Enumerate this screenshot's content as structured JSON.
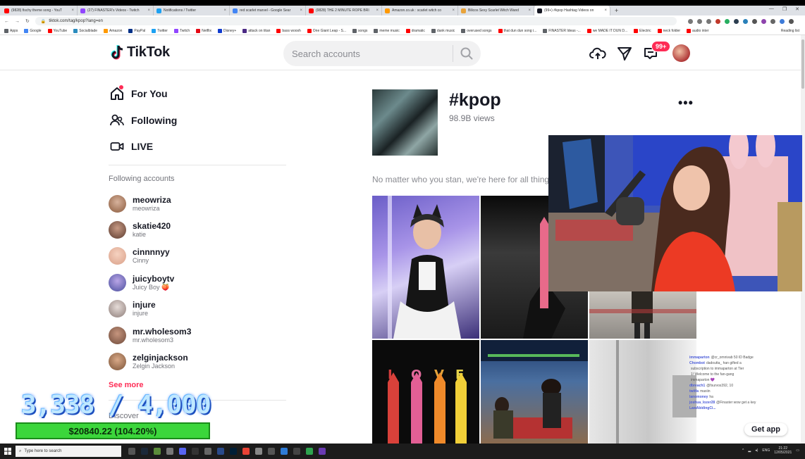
{
  "browser": {
    "tabs": [
      {
        "title": "(9828) fischy theme song - YouT",
        "color": "#ff0000"
      },
      {
        "title": "(27) FINASTER's Videos - Twitch",
        "color": "#9146ff"
      },
      {
        "title": "Notifications / Twitter",
        "color": "#1da1f2"
      },
      {
        "title": "red scarlet marvel - Google Sear",
        "color": "#4285f4"
      },
      {
        "title": "(9828) THE 2 MINUTE ROPE BRI",
        "color": "#ff0000"
      },
      {
        "title": "Amazon.co.uk : scarlet witch co",
        "color": "#ff9900"
      },
      {
        "title": "Bilicos Sexy Scarlet Witch Wand",
        "color": "#e8a33a"
      },
      {
        "title": "(99+) #kpop Hashtag Videos on",
        "color": "#161823"
      }
    ],
    "new_tab": "+",
    "url": "tiktok.com/tag/kpop?lang=en",
    "bookmarks": [
      {
        "label": "Apps",
        "color": "#5f6368"
      },
      {
        "label": "Google",
        "color": "#4285f4"
      },
      {
        "label": "YouTube",
        "color": "#ff0000"
      },
      {
        "label": "Socialblade",
        "color": "#2b8cbe"
      },
      {
        "label": "Amazon",
        "color": "#ff9900"
      },
      {
        "label": "PayPal",
        "color": "#003087"
      },
      {
        "label": "Twitter",
        "color": "#1da1f2"
      },
      {
        "label": "Twitch",
        "color": "#9146ff"
      },
      {
        "label": "Netflix",
        "color": "#e50914"
      },
      {
        "label": "Disney+",
        "color": "#113ccf"
      },
      {
        "label": "attack on titan",
        "color": "#4b2a84"
      },
      {
        "label": "bass woosh",
        "color": "#ff0000"
      },
      {
        "label": "One Giant Leap - S...",
        "color": "#ff0000"
      },
      {
        "label": "songs",
        "color": "#5f6368"
      },
      {
        "label": "meme music",
        "color": "#5f6368"
      },
      {
        "label": "dramatic",
        "color": "#ff0000"
      },
      {
        "label": "dank music",
        "color": "#5f6368"
      },
      {
        "label": "overused songs",
        "color": "#5f6368"
      },
      {
        "label": "that dun dun song i...",
        "color": "#ff0000"
      },
      {
        "label": "FINASTER Ideas -...",
        "color": "#5f6368"
      },
      {
        "label": "we MADE IT DUN D...",
        "color": "#ff0000"
      },
      {
        "label": "Electric",
        "color": "#ff0000"
      },
      {
        "label": "neck folder",
        "color": "#ff0000"
      },
      {
        "label": "audio inter",
        "color": "#ff0000"
      }
    ],
    "reading_list": "Reading list"
  },
  "header": {
    "logo": "TikTok",
    "search_placeholder": "Search accounts",
    "inbox_badge": "99+"
  },
  "sidebar": {
    "nav": [
      {
        "label": "For You",
        "icon": "home-icon"
      },
      {
        "label": "Following",
        "icon": "users-icon"
      },
      {
        "label": "LIVE",
        "icon": "live-icon"
      }
    ],
    "following_title": "Following accounts",
    "accounts": [
      {
        "handle": "meowriza",
        "name": "meowriza",
        "color": "#8a5a3c"
      },
      {
        "handle": "skatie420",
        "name": "katie",
        "color": "#5a3a2e"
      },
      {
        "handle": "cinnnnyy",
        "name": "Cinny",
        "color": "#d9a089"
      },
      {
        "handle": "juicyboytv",
        "name": "Juicy Boy 🍑",
        "color": "#6b6fb5"
      },
      {
        "handle": "injure",
        "name": "injure",
        "color": "#9c8a86"
      },
      {
        "handle": "mr.wholesom3",
        "name": "mr.wholesom3",
        "color": "#6e4a3a"
      },
      {
        "handle": "zelginjackson",
        "name": "Zelgin Jackson",
        "color": "#7a5236"
      }
    ],
    "see_more": "See more",
    "discover": "Discover"
  },
  "tag": {
    "title": "#kpop",
    "views": "98.9B views",
    "description": "No matter who you stan, we're here for all things",
    "more": "•••"
  },
  "chat": [
    {
      "user": "immaparton",
      "msg": "@cr_omnivab 50 ID Badge"
    },
    {
      "user": "Chombot",
      "msg": "dadoutta_ han gifted a"
    },
    {
      "user": "",
      "msg": "subscription to immaparton at Tier"
    },
    {
      "user": "",
      "msg": "1! Welcome to the fan-gang"
    },
    {
      "user": "",
      "msg": "immaparton 💜"
    },
    {
      "user": "dbreach1",
      "msg": "@fsurvos392, 10"
    },
    {
      "user": "twitfa",
      "msg": "maxiin"
    },
    {
      "user": "lanomoney",
      "msg": "ha"
    },
    {
      "user": "joshua_lozer28",
      "msg": "@Finaster wow get a key"
    },
    {
      "user": "LawAbidingCi...",
      "msg": ""
    }
  ],
  "get_app": "Get app",
  "stream": {
    "goal": "3,338 / 4,000",
    "donation": "$20840.22 (104.20%)"
  },
  "taskbar": {
    "search_placeholder": "Type here to search",
    "lang": "ENG",
    "time": "21:22",
    "date": "12/05/2021"
  }
}
